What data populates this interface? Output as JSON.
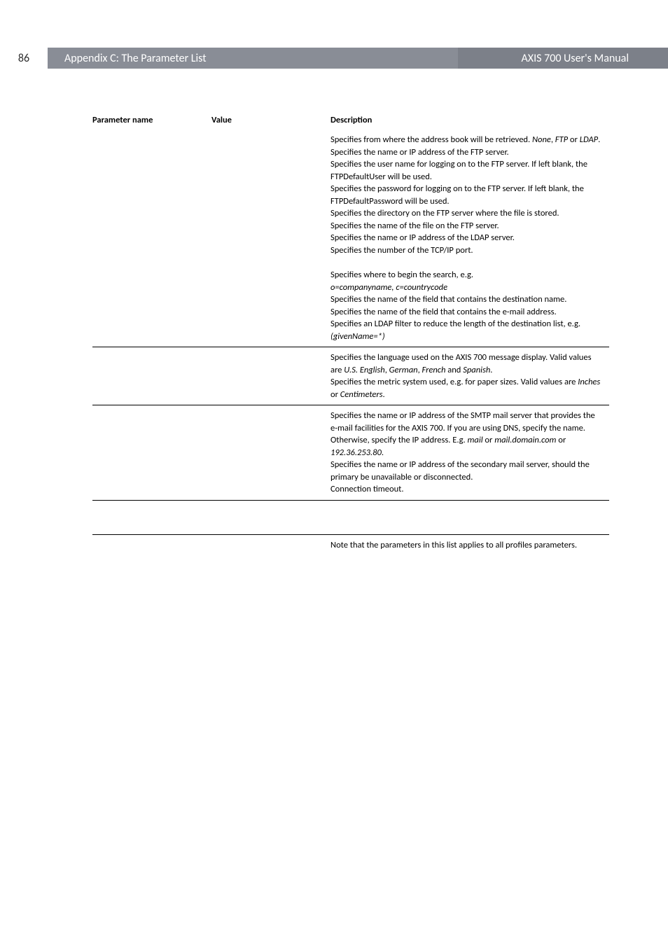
{
  "header": {
    "page_number": "86",
    "left_title": "Appendix C: The Parameter List",
    "right_title": "AXIS 700 User's Manual"
  },
  "table": {
    "headers": {
      "param": "Parameter name",
      "value": "Value",
      "desc": "Description"
    },
    "sections": [
      {
        "desc_lines": [
          {
            "type": "text",
            "parts": [
              "Specifies from where the address book will be retrieved. ",
              {
                "italic": "None"
              },
              ", ",
              {
                "italic": "FTP"
              },
              " or ",
              {
                "italic": "LDAP"
              },
              "."
            ]
          },
          {
            "type": "text",
            "parts": [
              "Specifies the name or IP address of the FTP server."
            ]
          },
          {
            "type": "text",
            "parts": [
              "Specifies the user name for logging on to the FTP server. If left blank, the FTPDefaultUser will be used."
            ]
          },
          {
            "type": "text",
            "parts": [
              "Specifies the password for logging on to the FTP server. If left blank, the FTPDefaultPassword will be used."
            ]
          },
          {
            "type": "text",
            "parts": [
              "Specifies the directory on the FTP server where the file is stored."
            ]
          },
          {
            "type": "text",
            "parts": [
              "Specifies the name of the file on the FTP server."
            ]
          },
          {
            "type": "text",
            "parts": [
              "Specifies the name or IP address of the LDAP server."
            ]
          },
          {
            "type": "text",
            "parts": [
              "Specifies the number of the TCP/IP port."
            ]
          },
          {
            "type": "spacer"
          },
          {
            "type": "text",
            "parts": [
              "Specifies where to begin the search, e.g."
            ]
          },
          {
            "type": "text",
            "parts": [
              {
                "italic": "o=companyname, c=countrycode"
              }
            ]
          },
          {
            "type": "text",
            "parts": [
              "Specifies the name of the field that contains the destination name."
            ]
          },
          {
            "type": "text",
            "parts": [
              "Specifies the name of the field that contains the e-mail address."
            ]
          },
          {
            "type": "text",
            "parts": [
              "Specifies an LDAP filter to reduce the length of the destination list, e.g. ",
              {
                "italic": "(givenName=*)"
              }
            ]
          }
        ]
      },
      {
        "desc_lines": [
          {
            "type": "text",
            "parts": [
              "Specifies the language used on the AXIS 700 message display. Valid values are ",
              {
                "italic": "U.S. English"
              },
              ", ",
              {
                "italic": "German"
              },
              ", ",
              {
                "italic": "French"
              },
              " and ",
              {
                "italic": "Spanish"
              },
              "."
            ]
          },
          {
            "type": "text",
            "parts": [
              "Specifies the metric system used, e.g. for paper sizes. Valid values are ",
              {
                "italic": "Inches"
              },
              " or ",
              {
                "italic": "Centimeters"
              },
              "."
            ]
          }
        ]
      },
      {
        "desc_lines": [
          {
            "type": "text",
            "parts": [
              "Specifies the name or IP address of the SMTP mail server that provides the e-mail facilities for the AXIS 700. If you are using DNS, specify the name. Otherwise, specify the IP address. E.g. ",
              {
                "italic": "mail"
              },
              " or ",
              {
                "italic": "mail.domain.com"
              },
              " or ",
              {
                "italic": "192.36.253.80"
              },
              "."
            ]
          },
          {
            "type": "text",
            "parts": [
              "Specifies the name or IP address of the secondary mail server, should the primary be unavailable or disconnected."
            ]
          },
          {
            "type": "text",
            "parts": [
              "Connection timeout."
            ]
          }
        ]
      },
      {
        "desc_lines": [
          {
            "type": "spacer"
          },
          {
            "type": "spacer"
          }
        ]
      },
      {
        "desc_lines": [
          {
            "type": "text",
            "parts": [
              "Note that the parameters in this list applies to all profiles parameters."
            ]
          }
        ]
      }
    ]
  }
}
